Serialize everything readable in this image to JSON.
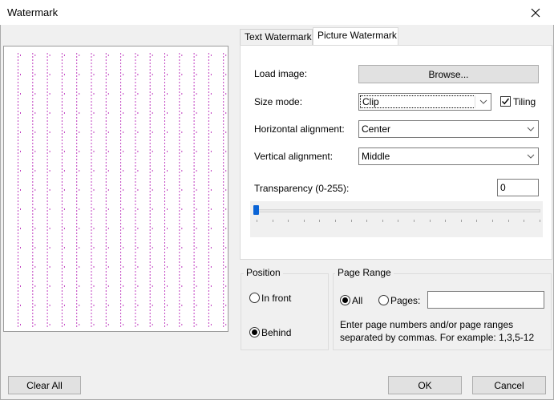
{
  "window": {
    "title": "Watermark",
    "close_icon": "close-icon"
  },
  "tabs": [
    {
      "label": "Text Watermark",
      "active": false
    },
    {
      "label": "Picture Watermark",
      "active": true
    }
  ],
  "picture": {
    "load_image_label": "Load image:",
    "browse_label": "Browse...",
    "size_mode_label": "Size mode:",
    "size_mode_value": "Clip",
    "tiling_label": "Tiling",
    "tiling_checked": true,
    "h_align_label": "Horizontal alignment:",
    "h_align_value": "Center",
    "v_align_label": "Vertical alignment:",
    "v_align_value": "Middle",
    "transparency_label": "Transparency (0-255):",
    "transparency_value": "0"
  },
  "position": {
    "title": "Position",
    "in_front_label": "In front",
    "behind_label": "Behind",
    "selected": "Behind"
  },
  "page_range": {
    "title": "Page Range",
    "all_label": "All",
    "pages_label": "Pages:",
    "selected": "All",
    "pages_value": "",
    "hint": "Enter page numbers and/or page ranges separated by commas. For example: 1,3,5-12"
  },
  "buttons": {
    "clear_all": "Clear All",
    "ok": "OK",
    "cancel": "Cancel"
  },
  "colors": {
    "watermark_dots": "#c040c0",
    "slider_thumb": "#0a64d6"
  }
}
